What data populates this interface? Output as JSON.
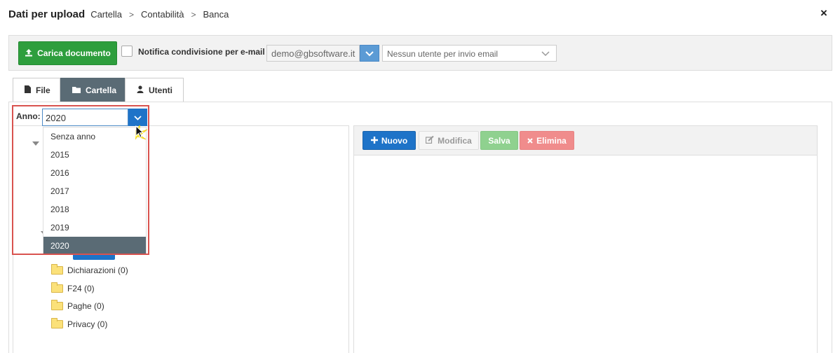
{
  "header": {
    "title": "Dati per upload",
    "breadcrumbs": [
      "Cartella",
      "Contabilità",
      "Banca"
    ],
    "breadcrumb_separator": ">",
    "close_icon": "×"
  },
  "toolbar": {
    "upload_label": "Carica documento",
    "notify_label": "Notifica condivisione per e-mail",
    "notify_checked": false,
    "email_value": "demo@gbsoftware.it",
    "user_select_placeholder": "Nessun utente per invio email",
    "upload_color": "#2e9e3d"
  },
  "tabs": [
    {
      "label": "File",
      "icon": "file-icon",
      "active": false
    },
    {
      "label": "Cartella",
      "icon": "folder-icon",
      "active": true
    },
    {
      "label": "Utenti",
      "icon": "user-icon",
      "active": false
    }
  ],
  "anno": {
    "label": "Anno:",
    "value": "2020",
    "options": [
      "Senza anno",
      "2015",
      "2016",
      "2017",
      "2018",
      "2019",
      "2020"
    ],
    "selected": "2020"
  },
  "tree": {
    "folders": [
      {
        "label": "Dichiarazioni (0)"
      },
      {
        "label": "F24 (0)"
      },
      {
        "label": "Paghe (0)"
      },
      {
        "label": "Privacy (0)"
      }
    ]
  },
  "actions": {
    "nuovo": "Nuovo",
    "modifica": "Modifica",
    "salva": "Salva",
    "elimina": "Elimina",
    "primary_color": "#1e73c8",
    "highlight_color": "#d9534f"
  }
}
